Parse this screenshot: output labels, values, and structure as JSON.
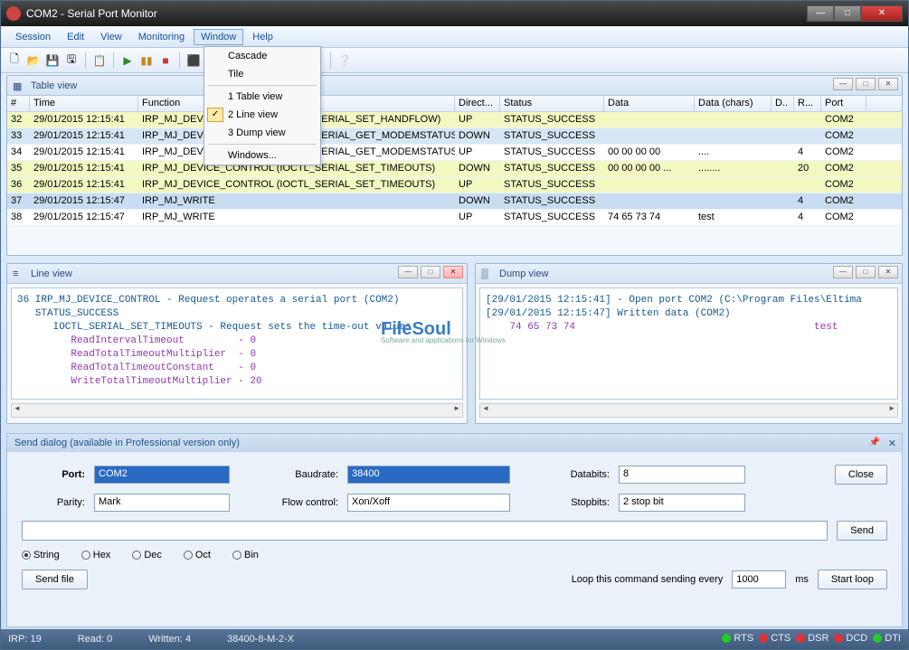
{
  "window": {
    "title": "COM2 - Serial Port Monitor"
  },
  "menubar": [
    "Session",
    "Edit",
    "View",
    "Monitoring",
    "Window",
    "Help"
  ],
  "dropdown": {
    "items": [
      "Cascade",
      "Tile",
      "1 Table view",
      "2 Line view",
      "3 Dump view",
      "Windows..."
    ],
    "checked_index": 3
  },
  "tableview": {
    "title": "Table view",
    "columns": [
      "#",
      "Time",
      "Function",
      "Direct...",
      "Status",
      "Data",
      "Data (chars)",
      "D..",
      "R...",
      "Port"
    ],
    "rows": [
      {
        "cls": "yel",
        "c": [
          "32",
          "29/01/2015 12:15:41",
          "IRP_MJ_DEVICE_CONTROL (IOCTL_SERIAL_SET_HANDFLOW)",
          "UP",
          "STATUS_SUCCESS",
          "",
          "",
          "",
          "",
          "COM2"
        ]
      },
      {
        "cls": "blue",
        "c": [
          "33",
          "29/01/2015 12:15:41",
          "IRP_MJ_DEVICE_CONTROL (IOCTL_SERIAL_GET_MODEMSTATUS)",
          "DOWN",
          "STATUS_SUCCESS",
          "",
          "",
          "",
          "",
          "COM2"
        ]
      },
      {
        "cls": "",
        "c": [
          "34",
          "29/01/2015 12:15:41",
          "IRP_MJ_DEVICE_CONTROL (IOCTL_SERIAL_GET_MODEMSTATUS)",
          "UP",
          "STATUS_SUCCESS",
          "00 00 00 00",
          "....",
          "",
          "4",
          "COM2"
        ]
      },
      {
        "cls": "yel",
        "c": [
          "35",
          "29/01/2015 12:15:41",
          "IRP_MJ_DEVICE_CONTROL (IOCTL_SERIAL_SET_TIMEOUTS)",
          "DOWN",
          "STATUS_SUCCESS",
          "00 00 00 00 ...",
          "........",
          "",
          "20",
          "COM2"
        ]
      },
      {
        "cls": "yel",
        "c": [
          "36",
          "29/01/2015 12:15:41",
          "IRP_MJ_DEVICE_CONTROL (IOCTL_SERIAL_SET_TIMEOUTS)",
          "UP",
          "STATUS_SUCCESS",
          "",
          "",
          "",
          "",
          "COM2"
        ]
      },
      {
        "cls": "sel",
        "c": [
          "37",
          "29/01/2015 12:15:47",
          "IRP_MJ_WRITE",
          "DOWN",
          "STATUS_SUCCESS",
          "",
          "",
          "",
          "4",
          "COM2"
        ]
      },
      {
        "cls": "",
        "c": [
          "38",
          "29/01/2015 12:15:47",
          "IRP_MJ_WRITE",
          "UP",
          "STATUS_SUCCESS",
          "74 65 73 74",
          "test",
          "",
          "4",
          "COM2"
        ]
      }
    ]
  },
  "lineview": {
    "title": "Line view",
    "lines": [
      {
        "t": "36 IRP_MJ_DEVICE_CONTROL - Request operates a serial port (COM2)",
        "cls": ""
      },
      {
        "t": "   STATUS_SUCCESS",
        "cls": ""
      },
      {
        "t": "      IOCTL_SERIAL_SET_TIMEOUTS - Request sets the time-out values",
        "cls": ""
      },
      {
        "t": "         ReadIntervalTimeout         - 0",
        "cls": "purple"
      },
      {
        "t": "         ReadTotalTimeoutMultiplier  - 0",
        "cls": "purple"
      },
      {
        "t": "         ReadTotalTimeoutConstant    - 0",
        "cls": "purple"
      },
      {
        "t": "         WriteTotalTimeoutMultiplier - 20",
        "cls": "purple"
      }
    ]
  },
  "dumpview": {
    "title": "Dump view",
    "lines": [
      {
        "t": "[29/01/2015 12:15:41] - Open port COM2 (C:\\Program Files\\Eltima",
        "cls": ""
      },
      {
        "t": "",
        "cls": ""
      },
      {
        "t": "[29/01/2015 12:15:47] Written data (COM2)",
        "cls": ""
      },
      {
        "t": "    74 65 73 74                                        test",
        "cls": "purple"
      }
    ]
  },
  "senddialog": {
    "title": "Send dialog (available in Professional version only)",
    "port_label": "Port:",
    "port_value": "COM2",
    "baud_label": "Baudrate:",
    "baud_value": "38400",
    "databits_label": "Databits:",
    "databits_value": "8",
    "parity_label": "Parity:",
    "parity_value": "Mark",
    "flow_label": "Flow control:",
    "flow_value": "Xon/Xoff",
    "stopbits_label": "Stopbits:",
    "stopbits_value": "2 stop bit",
    "close_btn": "Close",
    "send_btn": "Send",
    "radios": [
      "String",
      "Hex",
      "Dec",
      "Oct",
      "Bin"
    ],
    "sendfile_btn": "Send file",
    "loop_label": "Loop this command sending every",
    "loop_value": "1000",
    "loop_unit": "ms",
    "startloop_btn": "Start loop"
  },
  "statusbar": {
    "irp": "IRP: 19",
    "read": "Read: 0",
    "written": "Written: 4",
    "config": "38400-8-M-2-X",
    "leds": [
      {
        "name": "RTS",
        "color": "#2c2"
      },
      {
        "name": "CTS",
        "color": "#d33"
      },
      {
        "name": "DSR",
        "color": "#d33"
      },
      {
        "name": "DCD",
        "color": "#d33"
      },
      {
        "name": "DTI",
        "color": "#2c2"
      }
    ]
  },
  "watermark": {
    "main": "FileSoul",
    "sub": "Software and applications for Windows"
  }
}
